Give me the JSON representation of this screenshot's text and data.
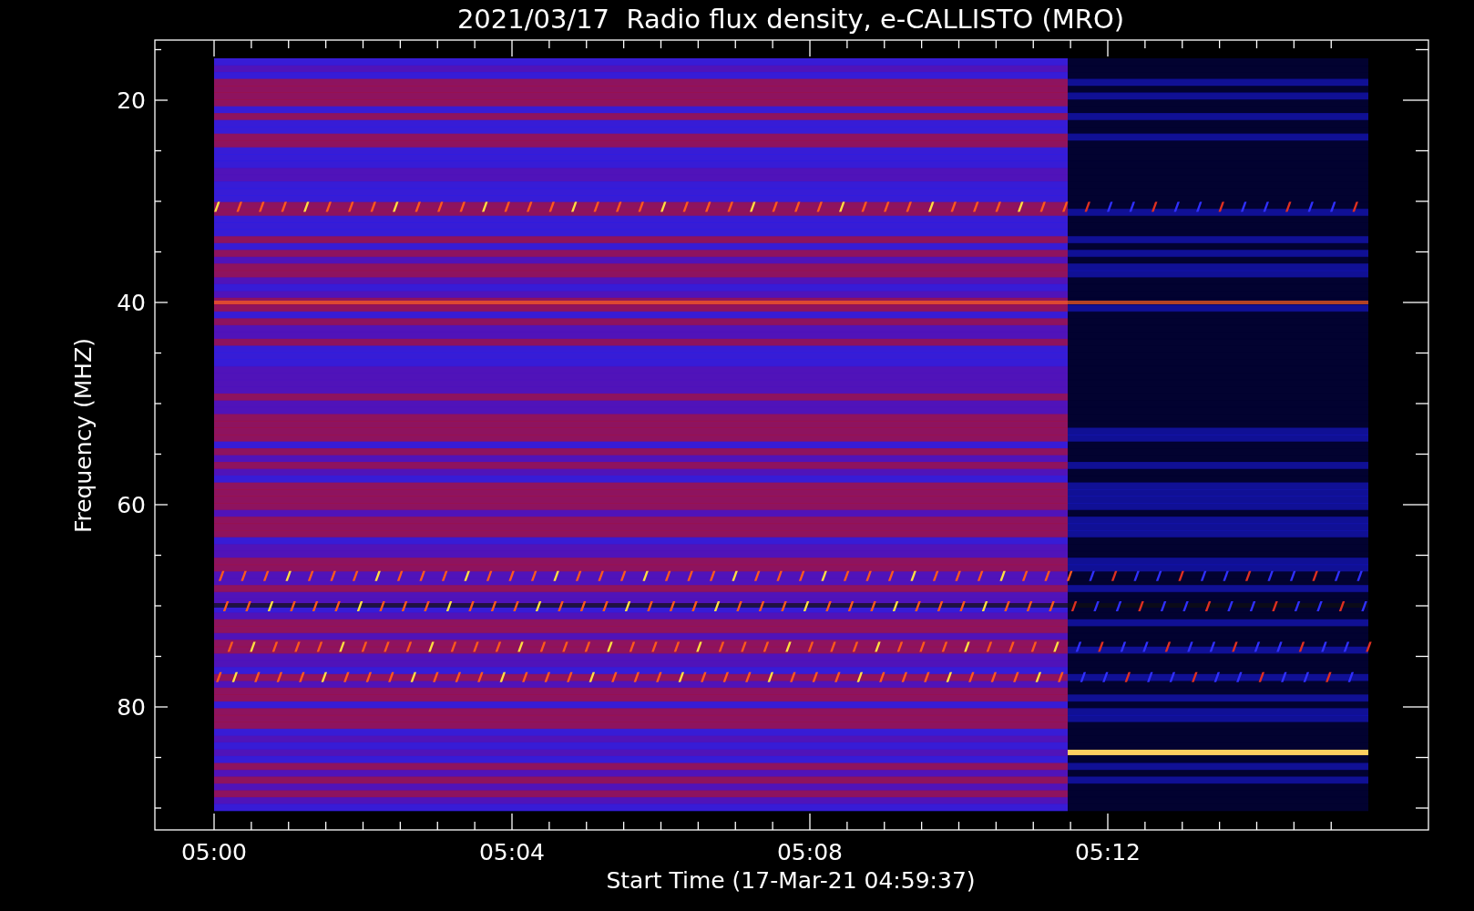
{
  "plot": {
    "title": "2021/03/17  Radio flux density, e-CALLISTO (MRO)",
    "ylabel": "Frequency (MHZ)",
    "xlabel": "Start Time (17-Mar-21 04:59:37)",
    "yticks": [
      "20",
      "40",
      "60",
      "80"
    ],
    "xticks": [
      "05:00",
      "05:04",
      "05:08",
      "05:12"
    ]
  }
}
